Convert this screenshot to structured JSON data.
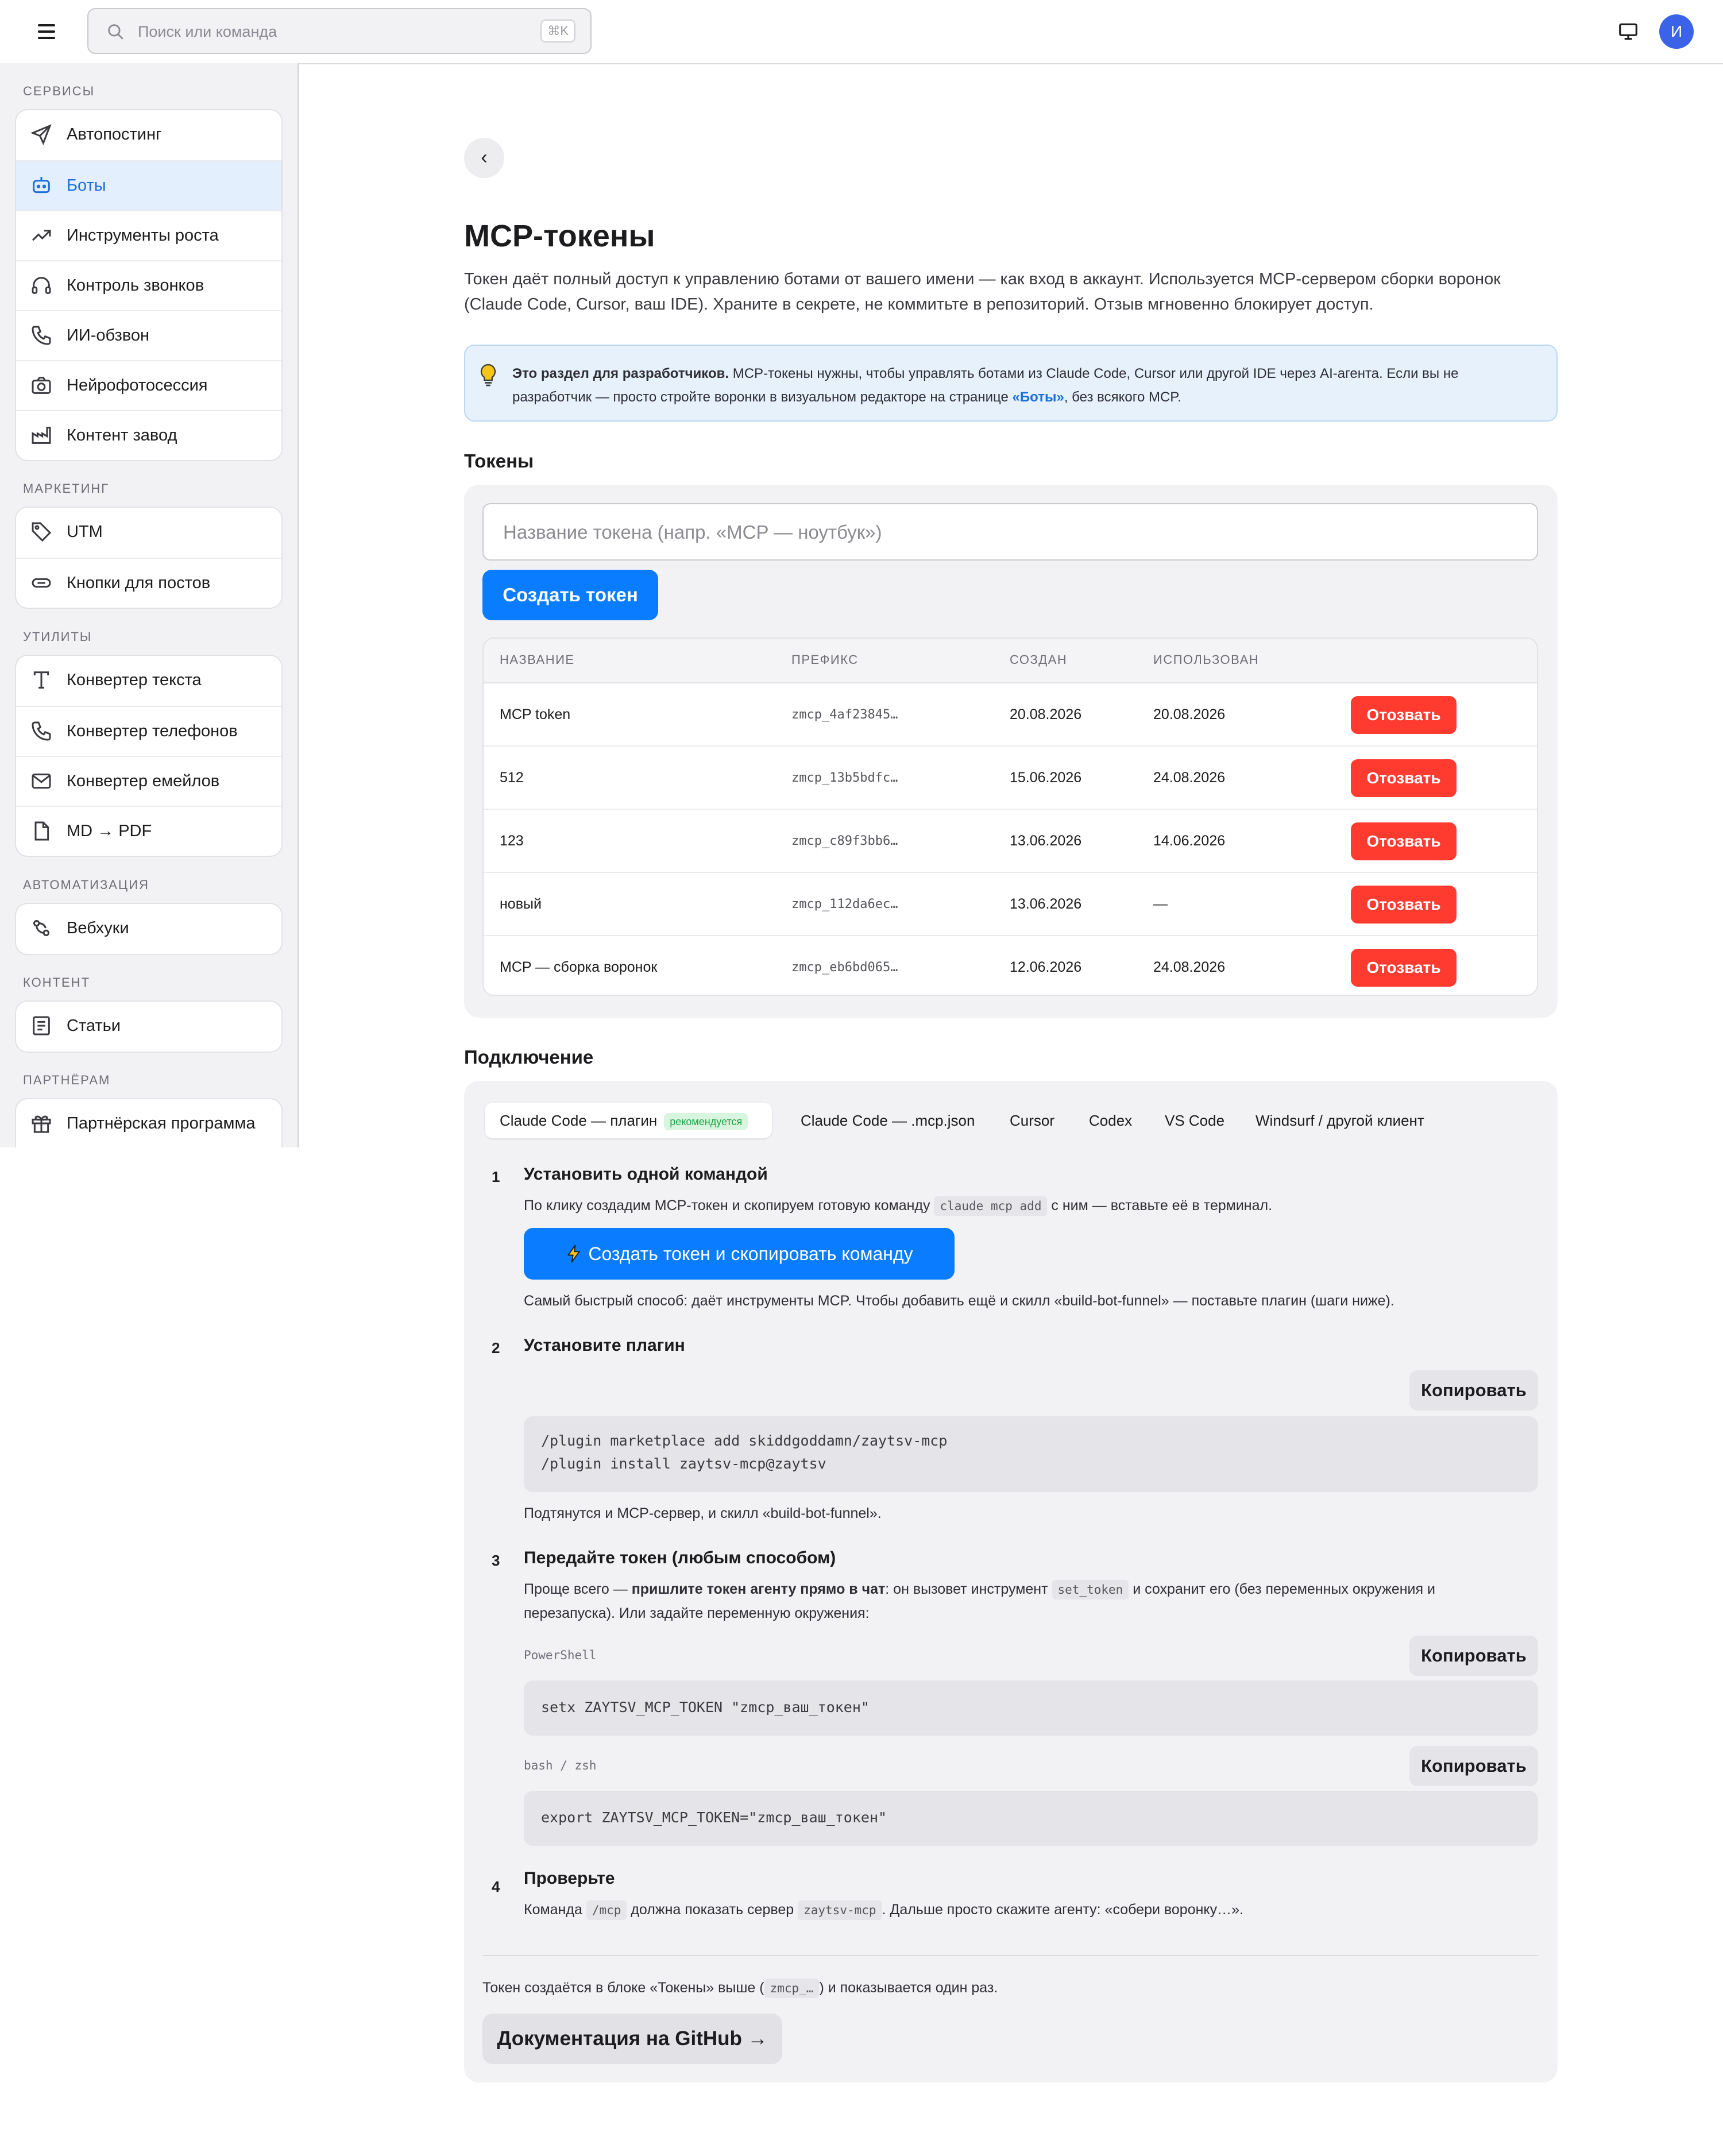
{
  "header": {
    "search_placeholder": "Поиск или команда",
    "search_shortcut": "⌘K",
    "avatar_initial": "И"
  },
  "sidebar": {
    "sections": [
      {
        "label": "СЕРВИСЫ",
        "items": [
          {
            "label": "Автопостинг",
            "icon": "send-icon"
          },
          {
            "label": "Боты",
            "icon": "bot-icon",
            "active": true
          },
          {
            "label": "Инструменты роста",
            "icon": "trending-up-icon"
          },
          {
            "label": "Контроль звонков",
            "icon": "headphones-icon"
          },
          {
            "label": "ИИ-обзвон",
            "icon": "phone-icon"
          },
          {
            "label": "Нейрофотосессия",
            "icon": "camera-icon"
          },
          {
            "label": "Контент завод",
            "icon": "factory-icon"
          }
        ]
      },
      {
        "label": "МАРКЕТИНГ",
        "items": [
          {
            "label": "UTM",
            "icon": "tag-icon"
          },
          {
            "label": "Кнопки для постов",
            "icon": "link-icon"
          }
        ]
      },
      {
        "label": "УТИЛИТЫ",
        "items": [
          {
            "label": "Конвертер текста",
            "icon": "text-icon"
          },
          {
            "label": "Конвертер телефонов",
            "icon": "phone-icon"
          },
          {
            "label": "Конвертер емейлов",
            "icon": "mail-icon"
          },
          {
            "label": "MD → PDF",
            "icon": "file-icon"
          }
        ]
      },
      {
        "label": "АВТОМАТИЗАЦИЯ",
        "items": [
          {
            "label": "Вебхуки",
            "icon": "webhook-icon"
          }
        ]
      },
      {
        "label": "КОНТЕНТ",
        "items": [
          {
            "label": "Статьи",
            "icon": "article-icon"
          }
        ]
      },
      {
        "label": "ПАРТНЁРАМ",
        "items": [
          {
            "label": "Партнёрская программа",
            "icon": "gift-icon"
          }
        ]
      }
    ]
  },
  "page": {
    "back_label": "‹",
    "title": "MCP-токены",
    "lead": "Токен даёт полный доступ к управлению ботами от вашего имени — как вход в аккаунт. Используется MCP-сервером сборки воронок (Claude Code, Cursor, ваш IDE). Храните в секрете, не коммитьте в репозиторий. Отзыв мгновенно блокирует доступ.",
    "info": {
      "bold": "Это раздел для разработчиков.",
      "text1": " MCP-токены нужны, чтобы управлять ботами из Claude Code, Cursor или другой IDE через AI-агента. Если вы не разработчик — просто стройте воронки в визуальном редакторе на странице ",
      "link": "«Боты»",
      "text2": ", без всякого MCP."
    }
  },
  "tokens": {
    "heading": "Токены",
    "input_placeholder": "Название токена (напр. «MCP — ноутбук»)",
    "create_label": "Создать токен",
    "columns": [
      "НАЗВАНИЕ",
      "ПРЕФИКС",
      "СОЗДАН",
      "ИСПОЛЬЗОВАН"
    ],
    "revoke_label": "Отозвать",
    "rows": [
      {
        "name": "MCP token",
        "prefix": "zmcp_4af23845…",
        "created": "20.08.2026",
        "used": "20.08.2026"
      },
      {
        "name": "512",
        "prefix": "zmcp_13b5bdfc…",
        "created": "15.06.2026",
        "used": "24.08.2026"
      },
      {
        "name": "123",
        "prefix": "zmcp_c89f3bb6…",
        "created": "13.06.2026",
        "used": "14.06.2026"
      },
      {
        "name": "новый",
        "prefix": "zmcp_112da6ec…",
        "created": "13.06.2026",
        "used": "—"
      },
      {
        "name": "MCP — сборка воронок",
        "prefix": "zmcp_eb6bd065…",
        "created": "12.06.2026",
        "used": "24.08.2026"
      }
    ]
  },
  "connection": {
    "heading": "Подключение",
    "tabs": [
      {
        "label": "Claude Code — плагин",
        "badge": "рекомендуется",
        "active": true
      },
      {
        "label": "Claude Code — .mcp.json"
      },
      {
        "label": "Cursor"
      },
      {
        "label": "Codex"
      },
      {
        "label": "VS Code"
      },
      {
        "label": "Windsurf / другой клиент"
      }
    ],
    "step1": {
      "num": "1",
      "title": "Установить одной командой",
      "text_a": "По клику создадим MCP-токен и скопируем готовую команду ",
      "code": "claude mcp add",
      "text_b": " с ним — вставьте её в терминал.",
      "button": "Создать токен и скопировать команду",
      "note": "Самый быстрый способ: даёт инструменты MCP. Чтобы добавить ещё и скилл «build-bot-funnel» — поставьте плагин (шаги ниже)."
    },
    "step2": {
      "num": "2",
      "title": "Установите плагин",
      "copy": "Копировать",
      "code_lines": [
        "/plugin marketplace add skiddgoddamn/zaytsv-mcp",
        "/plugin install zaytsv-mcp@zaytsv"
      ],
      "note": "Подтянутся и MCP-сервер, и скилл «build-bot-funnel»."
    },
    "step3": {
      "num": "3",
      "title": "Передайте токен (любым способом)",
      "text_a": "Проще всего — ",
      "bold": "пришлите токен агенту прямо в чат",
      "text_b": ": он вызовет инструмент ",
      "code": "set_token",
      "text_c": " и сохранит его (без переменных окружения и перезапуска). Или задайте переменную окружения:",
      "ps_label": "PowerShell",
      "ps_code": "setx ZAYTSV_MCP_TOKEN \"zmcp_ваш_токен\"",
      "sh_label": "bash / zsh",
      "sh_code": "export ZAYTSV_MCP_TOKEN=\"zmcp_ваш_токен\"",
      "copy": "Копировать"
    },
    "step4": {
      "num": "4",
      "title": "Проверьте",
      "text_a": "Команда ",
      "code1": "/mcp",
      "text_b": " должна показать сервер ",
      "code2": "zaytsv-mcp",
      "text_c": ". Дальше просто скажите агенту: «собери воронку…»."
    },
    "footer": {
      "text_a": "Токен создаётся в блоке «Токены» выше (",
      "code": "zmcp_…",
      "text_b": ") и показывается один раз.",
      "docs_button": "Документация на GitHub →"
    }
  }
}
